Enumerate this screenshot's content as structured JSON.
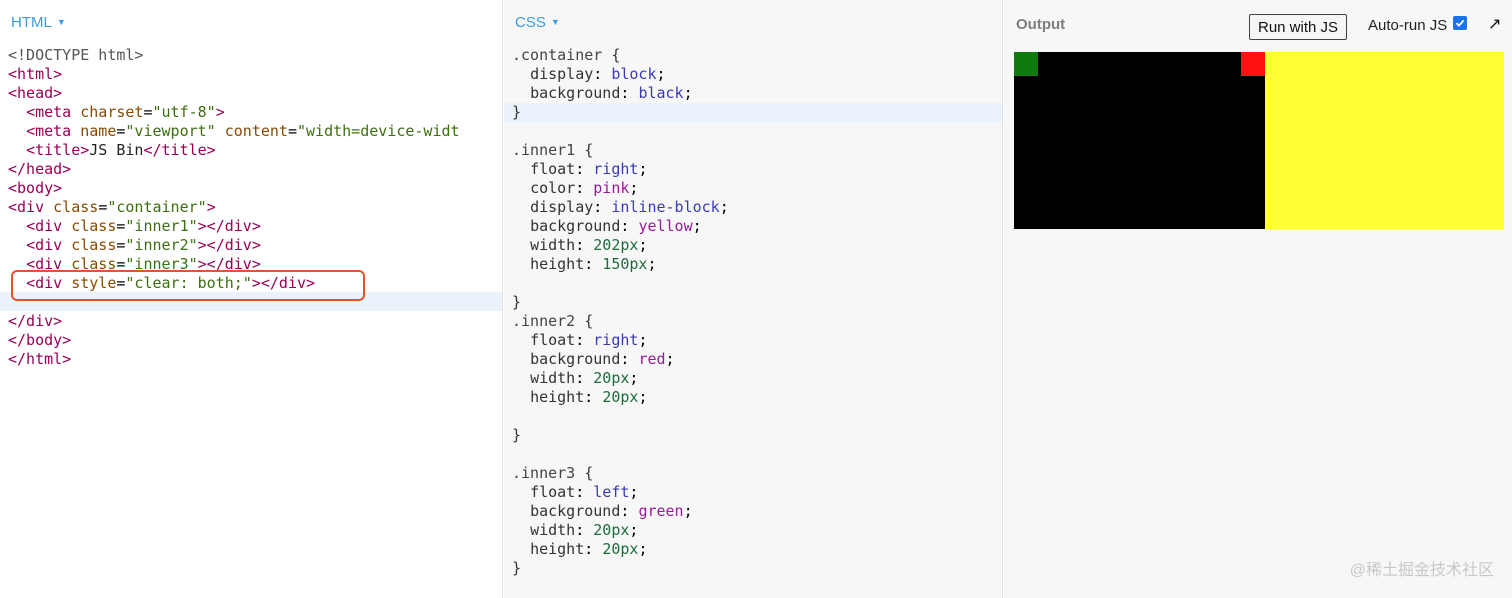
{
  "html_pane": {
    "label": "HTML"
  },
  "css_pane": {
    "label": "CSS"
  },
  "output_pane": {
    "label": "Output",
    "run_button": "Run with JS",
    "autorun_label": "Auto-run JS",
    "autorun_checked": true
  },
  "watermark": "@稀土掘金技术社区",
  "colors": {
    "header_accent": "#3c9bdc",
    "highlight_box": "#e5532b",
    "container_bg": "#000000",
    "inner1_bg": "#ffff33",
    "inner2_bg": "#ff1111",
    "inner3_bg": "#0f7a0f"
  },
  "icons": [
    "caret-down-icon",
    "checkbox-checked-icon",
    "popout-arrow-icon"
  ]
}
